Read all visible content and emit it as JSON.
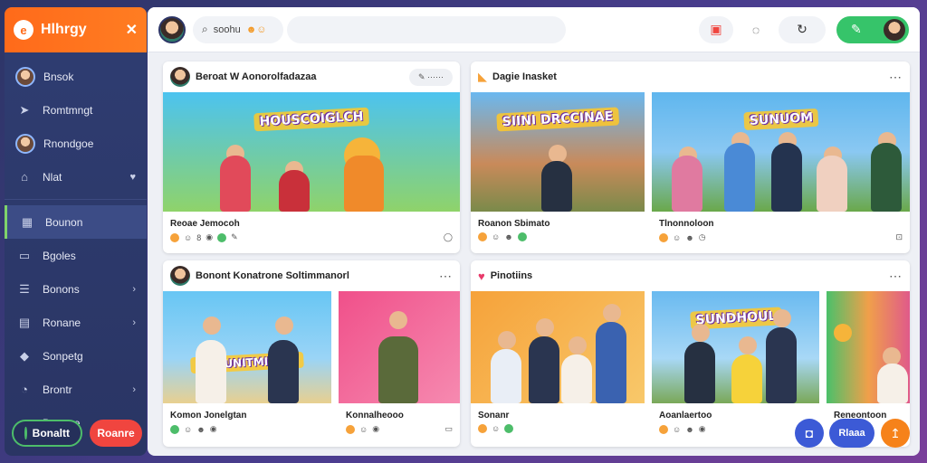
{
  "app": {
    "name": "Hlhrgy",
    "logo_glyph": "e",
    "close_glyph": "✕"
  },
  "sidebar": {
    "items": [
      {
        "label": "Bnsok",
        "icon": "avatar"
      },
      {
        "label": "Romtmngt",
        "icon": "pin-icon",
        "glyph": "➤"
      },
      {
        "label": "Rnondgoe",
        "icon": "avatar"
      },
      {
        "label": "Nlat",
        "icon": "house-icon",
        "glyph": "⌂",
        "chev": "♥"
      },
      {
        "label": "Bounon",
        "icon": "grid-icon",
        "glyph": "▦",
        "active": true
      },
      {
        "label": "Bgoles",
        "icon": "monitor-icon",
        "glyph": "▭"
      },
      {
        "label": "Bonons",
        "icon": "list-icon",
        "glyph": "☰",
        "chev": "›"
      },
      {
        "label": "Ronane",
        "icon": "card-icon",
        "glyph": "▤",
        "chev": "›"
      },
      {
        "label": "Sonpetg",
        "icon": "shield-icon",
        "glyph": "◆"
      },
      {
        "label": "Brontr",
        "icon": "bell-icon",
        "glyph": "◔",
        "chev": "›"
      },
      {
        "label": "Bonone",
        "icon": "none",
        "chev": "›"
      }
    ],
    "btn_left": "Bonaltt",
    "btn_right": "Roanre"
  },
  "topbar": {
    "search_text": "soohu",
    "search_emoji": "☻☺"
  },
  "cards": [
    {
      "title": "Beroat W Aonorolfadazaa",
      "pill": "✎ ⋯⋯",
      "tiles": [
        {
          "label": "Reoae Jemocoh",
          "meta": [
            "☺",
            "8",
            "◉",
            "✎",
            "◯"
          ]
        }
      ]
    },
    {
      "title": "Dagie Inasket",
      "tiles": [
        {
          "label": "Roanon Sbimato",
          "meta": [
            "☺",
            "☻",
            "◉"
          ]
        },
        {
          "label": "Tlnonnoloon",
          "meta": [
            "☺",
            "☻",
            "◷",
            "⊡"
          ]
        }
      ]
    },
    {
      "title": "Bonont Konatrone Soltimmanorl",
      "tiles": [
        {
          "label": "Komon Jonelgtan",
          "meta": [
            "☺",
            "☻",
            "◉"
          ]
        },
        {
          "label": "Konnalheooo",
          "meta": [
            "☺",
            "◉",
            "▭"
          ]
        }
      ]
    },
    {
      "title": "Pinotiins",
      "tiles": [
        {
          "label": "Sonanr",
          "meta": [
            "☺",
            "◉"
          ]
        },
        {
          "label": "Aoanlaertoo",
          "meta": [
            "☺",
            "☻",
            "◉"
          ]
        },
        {
          "label": "Reneontoon",
          "meta": []
        }
      ]
    }
  ],
  "thumb_banners": [
    "HOUSCOIGLCH",
    "SIINI DRCCINAE",
    "SUNUOM",
    "KOMUNITMITASE",
    "",
    "",
    "SUNDHOUL",
    ""
  ],
  "fab_label": "Rlaaa",
  "colors": {
    "accent": "#ff6a1a",
    "green": "#36c46a",
    "red": "#f0453f",
    "navy": "#2f3d72"
  }
}
